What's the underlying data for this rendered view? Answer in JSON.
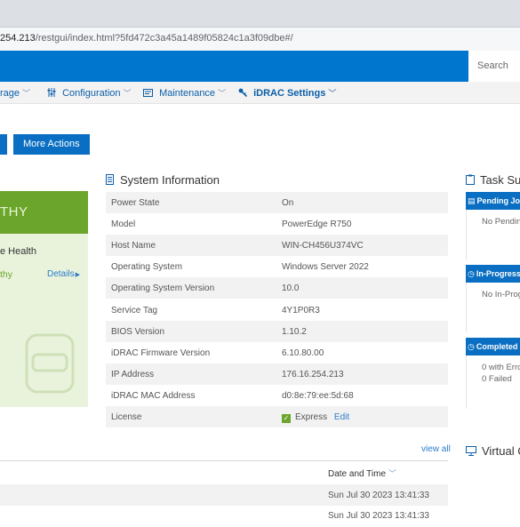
{
  "browser": {
    "url_prefix": "254.213",
    "url_rest": "/restgui/index.html?5fd472c3a45a1489f05824c1a3f09dbe#/"
  },
  "banner": {
    "search_placeholder": "Search"
  },
  "nav": {
    "storage": "rage",
    "configuration": "Configuration",
    "maintenance": "Maintenance",
    "idrac_settings": "iDRAC Settings"
  },
  "actions": {
    "more_actions": "More Actions"
  },
  "health": {
    "status": "THY",
    "heading": "e Health",
    "status_text": "thy",
    "details": "Details"
  },
  "system_info": {
    "title": "System Information",
    "rows": [
      {
        "label": "Power State",
        "value": "On"
      },
      {
        "label": "Model",
        "value": "PowerEdge R750"
      },
      {
        "label": "Host Name",
        "value": "WIN-CH456U374VC"
      },
      {
        "label": "Operating System",
        "value": "Windows Server 2022"
      },
      {
        "label": "Operating System Version",
        "value": "10.0"
      },
      {
        "label": "Service Tag",
        "value": "4Y1P0R3"
      },
      {
        "label": "BIOS Version",
        "value": "1.10.2"
      },
      {
        "label": "iDRAC Firmware Version",
        "value": "6.10.80.00"
      },
      {
        "label": "IP Address",
        "value": "176.16.254.213"
      },
      {
        "label": "iDRAC MAC Address",
        "value": "d0:8e:79:ee:5d:68"
      },
      {
        "label": "License",
        "value": "Express",
        "link": "Edit"
      }
    ]
  },
  "task_summary": {
    "title": "Task Su",
    "pending": {
      "head": "Pending Jo",
      "body": "No Pendin"
    },
    "in_progress": {
      "head": "In-Progress",
      "body": "No In-Prog"
    },
    "completed": {
      "head": "Completed",
      "line1": "0 with Erro",
      "line2": "0 Failed"
    }
  },
  "log": {
    "view_all": "view all",
    "date_header": "Date and Time",
    "rows": [
      "Sun Jul 30 2023 13:41:33",
      "Sun Jul 30 2023 13:41:33"
    ]
  },
  "virtual_console": {
    "title": "Virtual C"
  },
  "colors": {
    "brand_blue": "#0076ce",
    "healthy_green": "#6ba52b",
    "link_blue": "#0b5ea8"
  }
}
